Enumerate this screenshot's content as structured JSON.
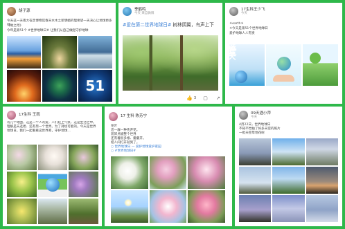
{
  "posts": [
    {
      "user": "胡子源",
      "text_1": "今天这一天南大在走博物馆春天水木之新明媚的理希望一天决心让地球更多绿…",
      "text_2": "《地之母》",
      "text_3": "今年是第51个 #世界地球日# 让我们从自己做起守护地球",
      "tile_number": "51"
    },
    {
      "user": "季鹤鸣",
      "subtitle": "今天 来自微博",
      "hashtag": "#爱在第二世界地球日#",
      "text": "树林阴翼，鸟声上下",
      "likes": "3"
    },
    {
      "user": "17生科王少飞",
      "subtitle": "今天",
      "text_1": "☀earth☀",
      "text_2": "☀今天是第51个世界地球日",
      "text_3": "爱护地球人人有责",
      "poster_line1": "爱",
      "poster_line2": "在",
      "poster_line3": "这天"
    },
    {
      "user": "17生科 王雨",
      "text": "有几个动图，这是一个人的爱，人们轻上气氛、这是生活之中。理解是天选者、还有另一个世界。为了持续可能的。今天是世界地球日。我们一起看看这世界吧，守护地球…"
    },
    {
      "user": "17 生科 陈芳宁",
      "text_1": "花叶",
      "text_2": "这一群一种先开花。",
      "text_3": "装饰点缀整个世界",
      "text_4": "还有着很多根、嫑嫑开。",
      "text_5": "把人间打开就到了。",
      "hashtag": "○ 世界地球日 — 爱护地球爱护家园",
      "hashtag_2": "○ #世界地球日#"
    },
    {
      "user": "09天酒小萍",
      "subtitle": "今天",
      "text_1": "4月22日，世界地球日",
      "text_2": "不知不觉拍了好多天空的照片",
      "text_3": "一批天空草地花树"
    }
  ],
  "colors": {
    "frame": "#2eb84a",
    "hashtag": "#3a7fd5"
  },
  "icons": [
    "avatar",
    "like-icon",
    "comment-icon",
    "share-icon"
  ]
}
